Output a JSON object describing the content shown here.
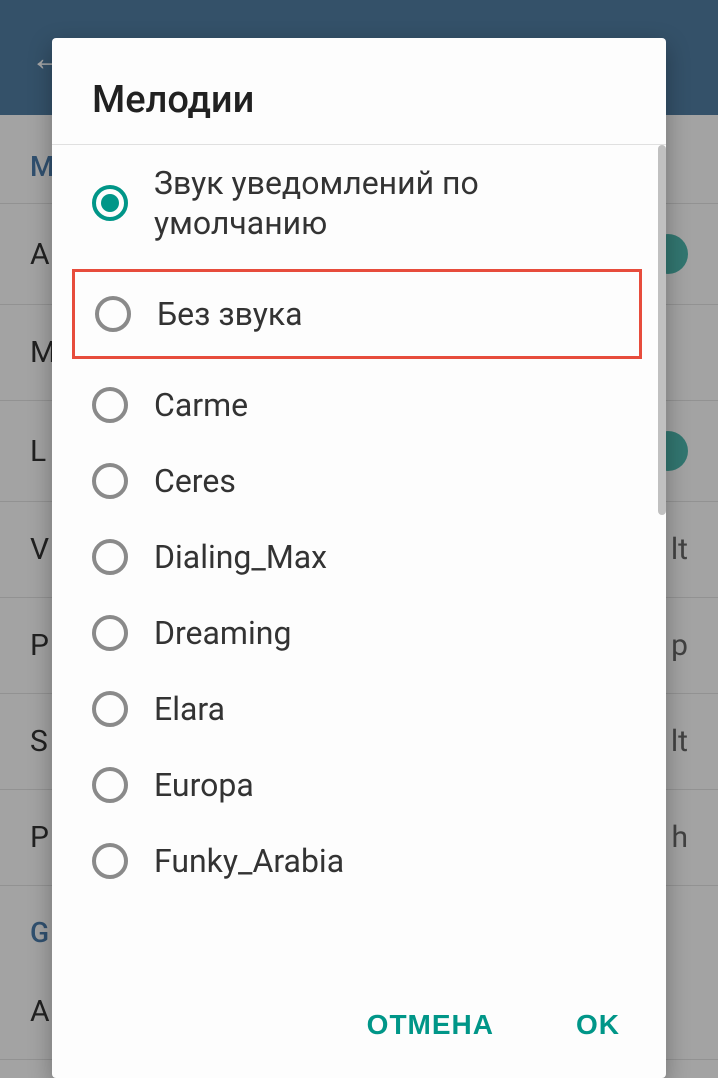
{
  "dialog": {
    "title": "Мелодии",
    "options": [
      {
        "label": "Звук уведомлений по умолчанию",
        "selected": true,
        "highlighted": false
      },
      {
        "label": "Без звука",
        "selected": false,
        "highlighted": true
      },
      {
        "label": "Carme",
        "selected": false,
        "highlighted": false
      },
      {
        "label": "Ceres",
        "selected": false,
        "highlighted": false
      },
      {
        "label": "Dialing_Max",
        "selected": false,
        "highlighted": false
      },
      {
        "label": "Dreaming",
        "selected": false,
        "highlighted": false
      },
      {
        "label": "Elara",
        "selected": false,
        "highlighted": false
      },
      {
        "label": "Europa",
        "selected": false,
        "highlighted": false
      },
      {
        "label": "Funky_Arabia",
        "selected": false,
        "highlighted": false
      }
    ],
    "cancel_label": "ОТМЕНА",
    "ok_label": "OK"
  },
  "background": {
    "section_label_1": "M",
    "items": [
      "A",
      "M",
      "L",
      "V",
      "P",
      "S",
      "P"
    ],
    "right_texts": [
      "",
      "",
      "",
      "lt",
      "p",
      "lt",
      "h"
    ],
    "group_label": "G",
    "item_last": "A"
  }
}
